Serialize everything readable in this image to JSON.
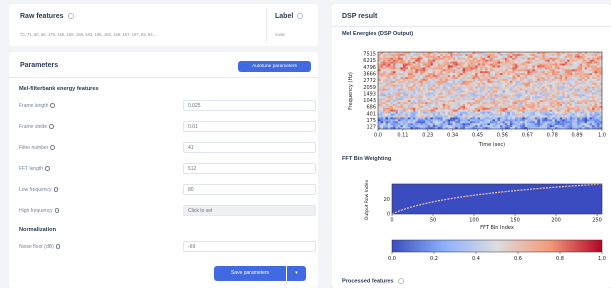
{
  "raw_features": {
    "title": "Raw features",
    "values": "73, 71, 60, 66, 178, 155, 166, 168, 181, 195, 183, 166, 167, 167, 82, 84,...",
    "label_title": "Label",
    "label_value": "noise"
  },
  "parameters": {
    "title": "Parameters",
    "autotune_label": "Autotune parameters",
    "mel_section": "Mel-filterbank energy features",
    "fields": [
      {
        "label": "Frame length",
        "value": "0.025"
      },
      {
        "label": "Frame stride",
        "value": "0.01"
      },
      {
        "label": "Filter number",
        "value": "41"
      },
      {
        "label": "FFT length",
        "value": "512"
      },
      {
        "label": "Low frequency",
        "value": "80"
      },
      {
        "label": "High frequency",
        "value": "Click to set"
      }
    ],
    "normalization_section": "Normalization",
    "noise_floor": {
      "label": "Noise floor (dB)",
      "value": "-69"
    },
    "save_label": "Save parameters",
    "save_dropdown": "▾"
  },
  "dsp": {
    "title": "DSP result",
    "mel_title": "Mel Energies (DSP Output)",
    "fft_title": "FFT Bin Weighting",
    "processed_title": "Processed features"
  },
  "chart_data": [
    {
      "type": "heatmap",
      "title": "Mel Energies (DSP Output)",
      "xlabel": "Time (sec)",
      "ylabel": "Frequency (Hz)",
      "x_ticks": [
        "0.0",
        "0.11",
        "0.23",
        "0.34",
        "0.45",
        "0.56",
        "0.67",
        "0.78",
        "0.89",
        "1.0"
      ],
      "y_ticks": [
        "7515",
        "6215",
        "4796",
        "3666",
        "2772",
        "2059",
        "1493",
        "1043",
        "686",
        "401",
        "175",
        "127"
      ]
    },
    {
      "type": "heatmap",
      "title": "FFT Bin Weighting",
      "xlabel": "FFT Bin Index",
      "ylabel": "Output Row Index",
      "x_ticks": [
        "0",
        "50",
        "100",
        "150",
        "200",
        "250"
      ],
      "y_ticks": [
        "20",
        "0"
      ],
      "xlim": [
        0,
        256
      ],
      "ylim": [
        0,
        41
      ]
    },
    {
      "type": "heatmap",
      "colorbar_ticks": [
        "0.0",
        "0.2",
        "0.4",
        "0.6",
        "0.8",
        "1.0"
      ],
      "range": [
        0,
        1
      ]
    }
  ]
}
